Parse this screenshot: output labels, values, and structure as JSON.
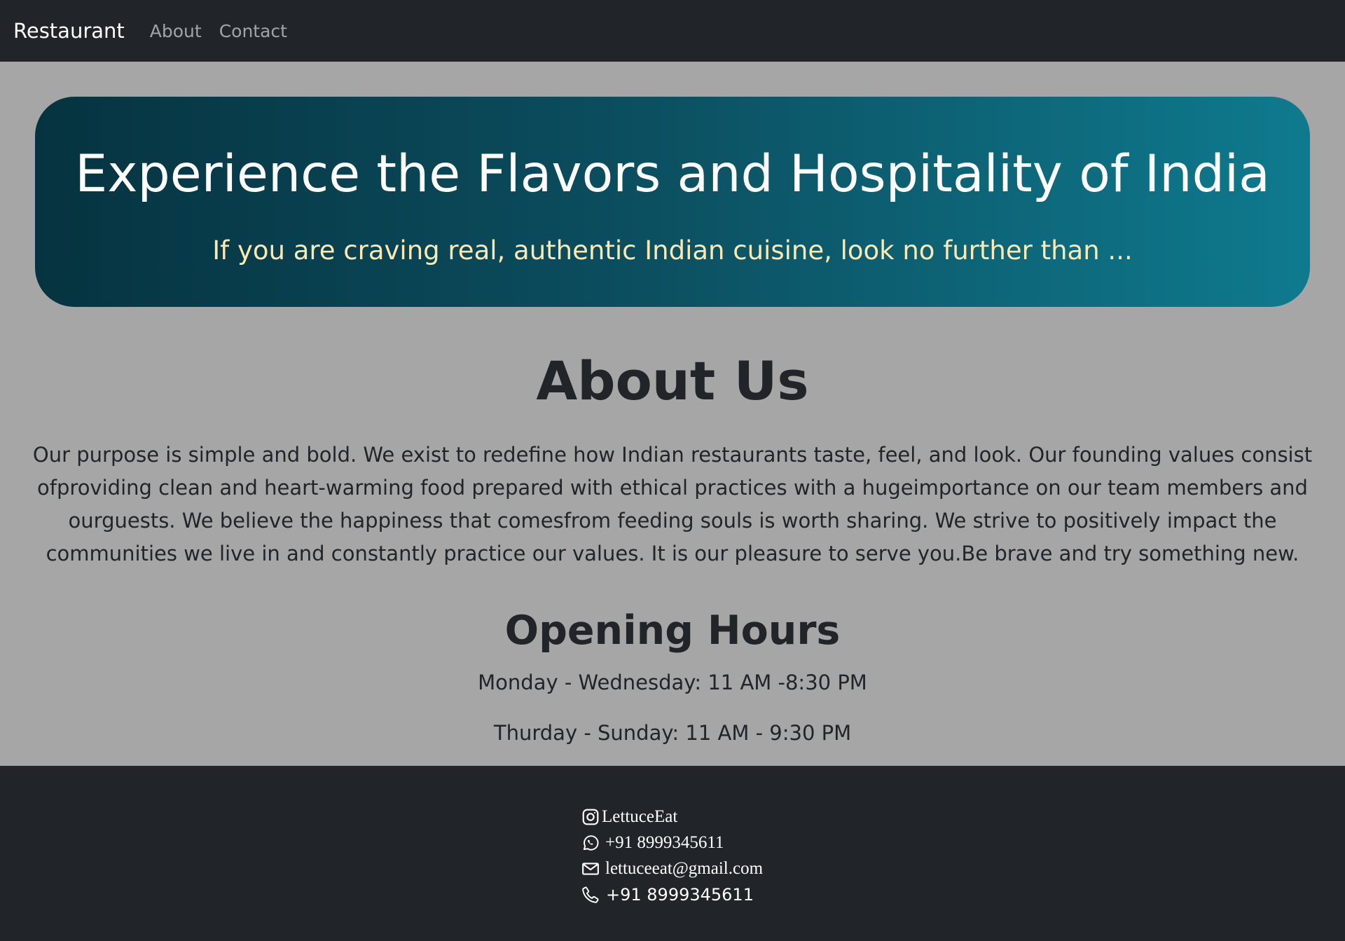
{
  "navbar": {
    "brand": "Restaurant",
    "links": [
      "About",
      "Contact"
    ]
  },
  "hero": {
    "title": "Experience the Flavors and Hospitality of India",
    "subtitle": "If you are craving real, authentic Indian cuisine, look no further than ..."
  },
  "about": {
    "title": "About Us",
    "text": "Our purpose is simple and bold. We exist to redefine how Indian restaurants taste, feel, and look. Our founding values consist ofproviding clean and heart-warming food prepared with ethical practices with a hugeimportance on our team members and ourguests. We believe the happiness that comesfrom feeding souls is worth sharing. We strive to positively impact the communities we live in and constantly practice our values. It is our pleasure to serve you.Be brave and try something new."
  },
  "hours": {
    "title": "Opening Hours",
    "lines": [
      "Monday - Wednesday: 11 AM -8:30 PM",
      "Thurday - Sunday: 11 AM - 9:30 PM"
    ]
  },
  "footer": {
    "contacts": [
      {
        "icon": "instagram-icon",
        "text": "LettuceEat"
      },
      {
        "icon": "whatsapp-icon",
        "text": "+91 8999345611"
      },
      {
        "icon": "envelope-icon",
        "text": "lettuceeat@gmail.com"
      },
      {
        "icon": "phone-icon",
        "text": "+91 8999345611"
      }
    ]
  },
  "colors": {
    "navbar_bg": "#212529",
    "page_bg": "#a6a6a6",
    "hero_gradient_start": "#063340",
    "hero_gradient_end": "#0f7a8e",
    "hero_subtitle": "#fde9b0"
  }
}
